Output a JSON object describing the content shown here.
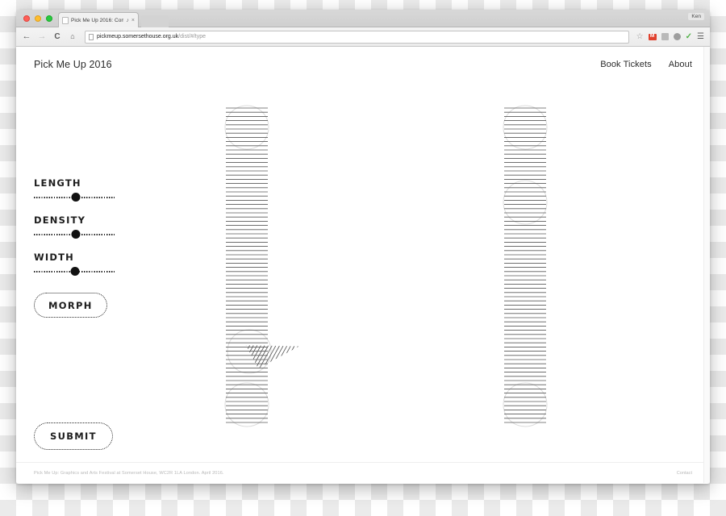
{
  "browser": {
    "tab": {
      "title": "Pick Me Up 2016: Com",
      "favicon": "page-icon",
      "audio_icon": "speaker-icon",
      "close_icon": "close-icon"
    },
    "toolbar": {
      "back_icon": "back-arrow-icon",
      "forward_icon": "forward-arrow-icon",
      "reload_icon": "reload-icon",
      "home_icon": "home-icon",
      "url_host": "pickmeup.somersethouse.org.uk",
      "url_path": "/dist/#/type",
      "bookmark_icon": "star-icon",
      "extensions": [
        {
          "name": "gmail-icon",
          "glyph": "M"
        },
        {
          "name": "screenshot-icon",
          "glyph": ""
        },
        {
          "name": "globe-icon",
          "glyph": ""
        },
        {
          "name": "checkmark-icon",
          "glyph": "✓"
        }
      ],
      "menu_icon": "hamburger-menu-icon",
      "profile_name": "Ken"
    }
  },
  "page": {
    "brand": "Pick Me Up 2016",
    "nav": [
      {
        "label": "Book Tickets"
      },
      {
        "label": "About"
      }
    ],
    "controls": {
      "sliders": [
        {
          "label": "LENGTH",
          "value": 52,
          "min": 0,
          "max": 100
        },
        {
          "label": "DENSITY",
          "value": 52,
          "min": 0,
          "max": 100
        },
        {
          "label": "WIDTH",
          "value": 51,
          "min": 0,
          "max": 100
        }
      ],
      "morph_label": "MORPH",
      "submit_label": "SUBMIT"
    },
    "artwork": {
      "name": "hatched-letterform-H",
      "description": "Two vertical bars filled with horizontal hatch lines joined by a diagonal crossbar of angled hatch lines, with faint circular node outlines at each stroke terminal and joint.",
      "hatch_color": "#555555",
      "node_circle_color": "#d8d8d8"
    },
    "footer": {
      "text": "Pick Me Up: Graphics and Arts Festival at Somerset House, WC2R 1LA London. April 2016.",
      "link": "Contact"
    }
  },
  "colors": {
    "page_background": "#ffffff",
    "ink": "#1d1d1d",
    "hatch": "#555555",
    "muted": "#b9b9b9"
  }
}
